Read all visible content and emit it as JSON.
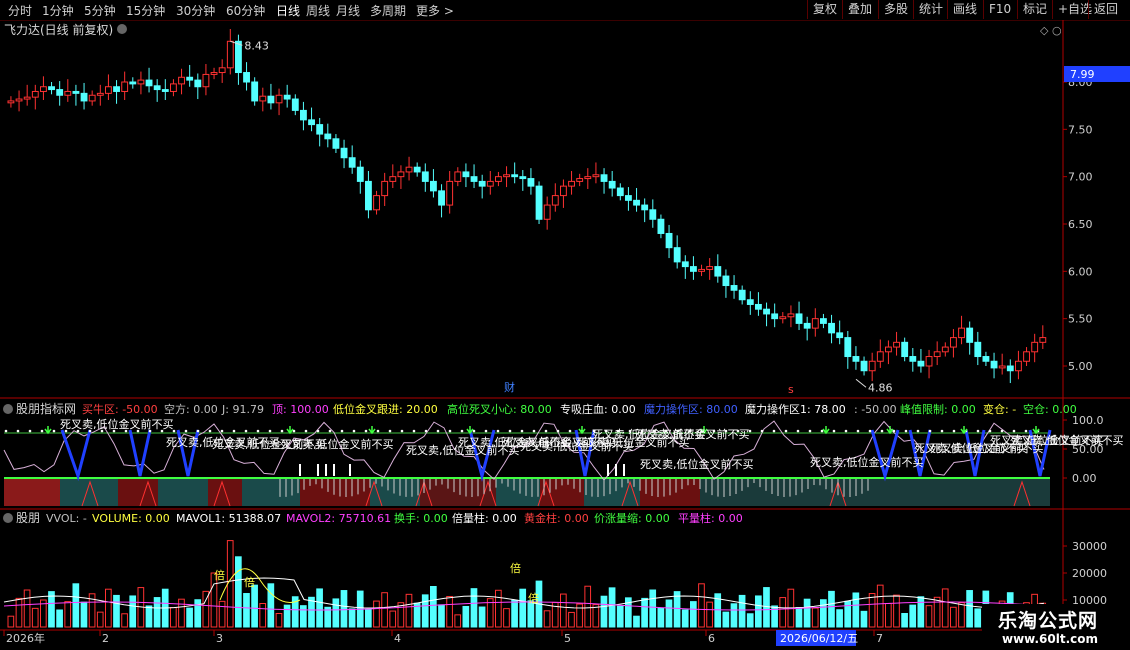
{
  "toolbar": {
    "periods": [
      "分时",
      "1分钟",
      "5分钟",
      "15分钟",
      "30分钟",
      "60分钟",
      "日线",
      "周线",
      "月线",
      "多周期",
      "更多 >"
    ],
    "active": "日线",
    "right_buttons": [
      "复权",
      "叠加",
      "多股",
      "统计",
      "画线",
      "F10",
      "标记",
      "+自选",
      "返回"
    ]
  },
  "main_chart": {
    "title": "飞力达(日线 前复权)",
    "high_marker": "8.43",
    "low_marker": "4.86",
    "current_price": "7.99",
    "y_ticks": [
      "8.00",
      "7.50",
      "7.00",
      "6.50",
      "6.00",
      "5.50",
      "5.00"
    ],
    "markers": {
      "cai": "财",
      "s": "s"
    }
  },
  "indicator_panel": {
    "name": "股朋指标网",
    "items": [
      {
        "text": "买牛区: -50.00",
        "color": "#ff4040"
      },
      {
        "text": "空方: 0.00",
        "color": "#c0c0c0"
      },
      {
        "text": "J: 91.79",
        "color": "#c0c0c0"
      },
      {
        "text": "顶: 100.00",
        "color": "#ff40ff"
      },
      {
        "text": "低位金叉跟进: 20.00",
        "color": "#ffff40"
      },
      {
        "text": "高位死叉小心: 80.00",
        "color": "#40ff40"
      },
      {
        "text": "专吸庄血: 0.00",
        "color": "#ffffff"
      },
      {
        "text": "魔力操作区: 80.00",
        "color": "#4060ff"
      },
      {
        "text": "魔力操作区1: 78.00",
        "color": "#ffffff"
      },
      {
        "text": ": -50.00",
        "color": "#c0c0c0"
      },
      {
        "text": "峰值限制: 0.00",
        "color": "#40ff40"
      },
      {
        "text": "变仓: -",
        "color": "#ffff40"
      },
      {
        "text": "空仓: 0.00",
        "color": "#40ff40"
      }
    ],
    "y_ticks": [
      "100.0",
      "50.00",
      "0.00"
    ],
    "annotation": "死叉卖,低位金叉前不买"
  },
  "volume_panel": {
    "name": "股朋",
    "items": [
      {
        "text": "VVOL: -",
        "color": "#c0c0c0"
      },
      {
        "text": "VOLUME: 0.00",
        "color": "#ffff40"
      },
      {
        "text": "MAVOL1: 51388.07",
        "color": "#ffffff"
      },
      {
        "text": "MAVOL2: 75710.61",
        "color": "#ff40ff"
      },
      {
        "text": "换手: 0.00",
        "color": "#40ff40"
      },
      {
        "text": "倍量柱: 0.00",
        "color": "#ffffff"
      },
      {
        "text": "黄金柱: 0.00",
        "color": "#ff4040"
      },
      {
        "text": "价涨量缩: 0.00",
        "color": "#40ff40"
      },
      {
        "text": "平量柱: 0.00",
        "color": "#ff40ff"
      }
    ],
    "y_ticks": [
      "30000",
      "20000",
      "10000"
    ],
    "bar_labels": [
      "倍",
      "倍",
      "倍",
      "倍"
    ]
  },
  "time_axis": {
    "labels": [
      "2026年",
      "2",
      "3",
      "4",
      "5",
      "6",
      "7"
    ],
    "cursor_date": "2026/06/12/五"
  },
  "watermark": {
    "line1": "乐淘公式网",
    "line2": "www.60lt.com"
  },
  "colors": {
    "up": "#ff3232",
    "down": "#54ffff",
    "ma1": "#ffffff",
    "ma2": "#ff40ff",
    "axis": "#b00000"
  }
}
